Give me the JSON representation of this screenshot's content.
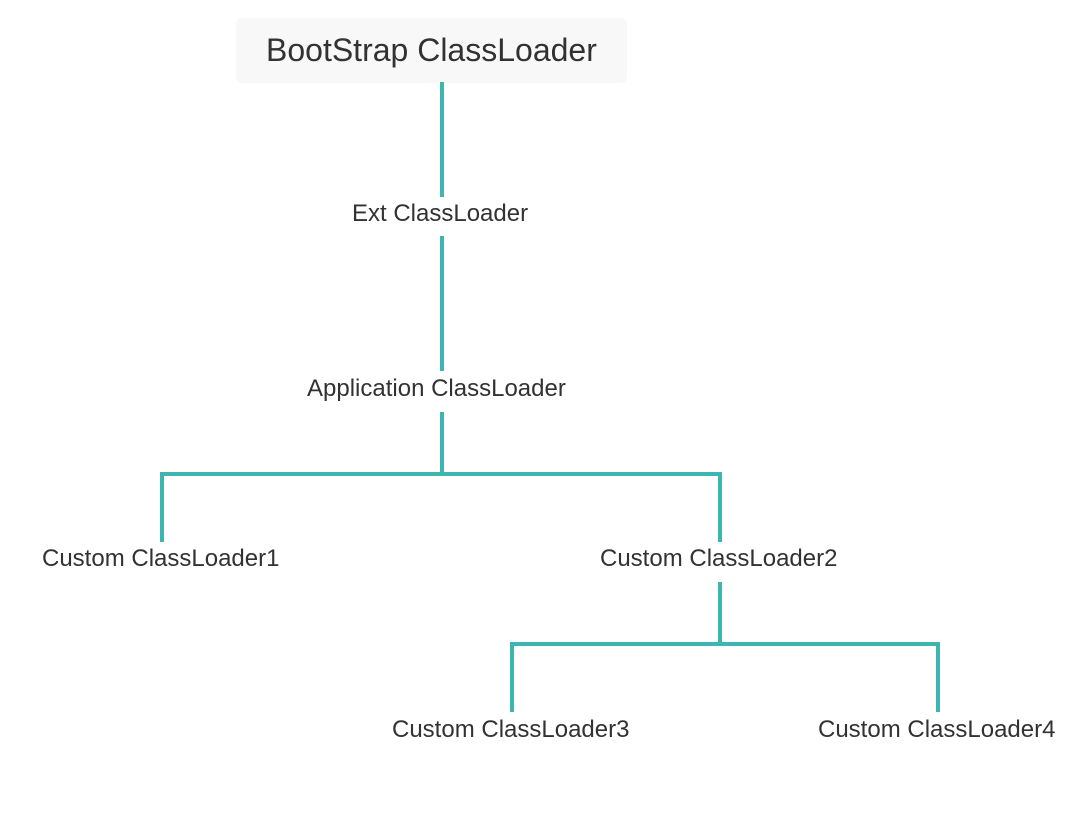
{
  "nodes": {
    "root": "BootStrap ClassLoader",
    "ext": "Ext ClassLoader",
    "app": "Application ClassLoader",
    "custom1": "Custom ClassLoader1",
    "custom2": "Custom ClassLoader2",
    "custom3": "Custom ClassLoader3",
    "custom4": "Custom ClassLoader4"
  },
  "colors": {
    "line": "#3db5b0",
    "rootBg": "#f8f8f8",
    "text": "#323232"
  }
}
